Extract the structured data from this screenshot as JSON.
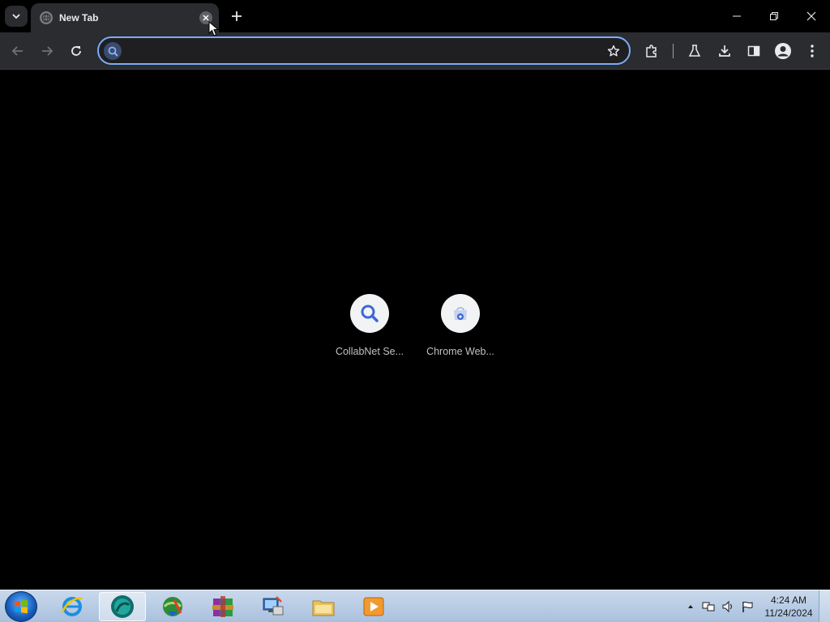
{
  "browser": {
    "tab": {
      "title": "New Tab",
      "close_label": "Close"
    },
    "new_tab_label": "New tab",
    "window": {
      "minimize": "Minimize",
      "restore": "Restore",
      "close": "Close"
    },
    "omnibox": {
      "value": "",
      "placeholder": ""
    }
  },
  "shortcuts": [
    {
      "label": "CollabNet Se...",
      "icon": "search-icon"
    },
    {
      "label": "Chrome Web...",
      "icon": "chrome-web-store-icon"
    }
  ],
  "taskbar": {
    "apps": [
      {
        "name": "internet-explorer-icon"
      },
      {
        "name": "chrome-app-icon"
      },
      {
        "name": "download-manager-icon"
      },
      {
        "name": "winrar-icon"
      },
      {
        "name": "network-app-icon"
      },
      {
        "name": "file-explorer-icon"
      },
      {
        "name": "media-player-icon"
      }
    ],
    "clock": {
      "time": "4:24 AM",
      "date": "11/24/2024"
    }
  },
  "colors": {
    "accent": "#7cacf8",
    "toolbar": "#2b2c30",
    "content_bg": "#000000"
  }
}
